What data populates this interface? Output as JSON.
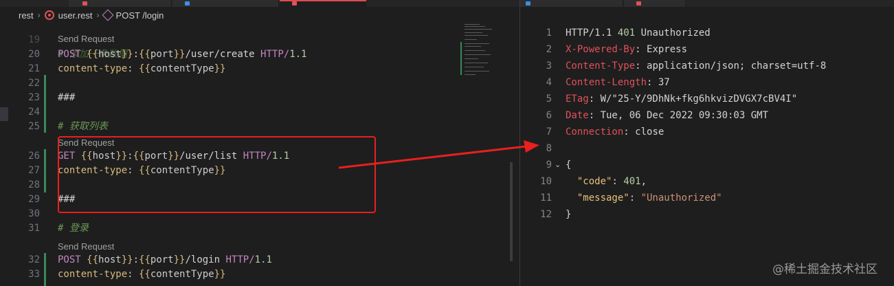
{
  "breadcrumb": {
    "folder": "rest",
    "file": "user.rest",
    "symbol": "POST /login"
  },
  "editor": {
    "lines": [
      {
        "num": "20",
        "tokens": [
          {
            "t": "POST",
            "c": "t-method"
          },
          {
            "t": " ",
            "c": ""
          },
          {
            "t": "{{",
            "c": "t-brace"
          },
          {
            "t": "host",
            "c": "t-var"
          },
          {
            "t": "}}",
            "c": "t-brace"
          },
          {
            "t": ":",
            "c": "t-path"
          },
          {
            "t": "{{",
            "c": "t-brace"
          },
          {
            "t": "port",
            "c": "t-var"
          },
          {
            "t": "}}",
            "c": "t-brace"
          },
          {
            "t": "/user/create ",
            "c": "t-path"
          },
          {
            "t": "HTTP/",
            "c": "t-proto"
          },
          {
            "t": "1.1",
            "c": "t-ver"
          }
        ]
      },
      {
        "num": "21",
        "tokens": [
          {
            "t": "content-type",
            "c": "t-hname"
          },
          {
            "t": ": ",
            "c": "t-sep"
          },
          {
            "t": "{{",
            "c": "t-brace"
          },
          {
            "t": "contentType",
            "c": "t-var"
          },
          {
            "t": "}}",
            "c": "t-brace"
          }
        ]
      },
      {
        "num": "22",
        "tokens": []
      },
      {
        "num": "23",
        "tokens": [
          {
            "t": "###",
            "c": "t-path"
          }
        ]
      },
      {
        "num": "24",
        "tokens": []
      },
      {
        "num": "25",
        "tokens": [
          {
            "t": "# 获取列表",
            "c": "t-comment"
          }
        ]
      },
      {
        "num": "26",
        "tokens": [
          {
            "t": "GET",
            "c": "t-method"
          },
          {
            "t": " ",
            "c": ""
          },
          {
            "t": "{{",
            "c": "t-brace"
          },
          {
            "t": "host",
            "c": "t-var"
          },
          {
            "t": "}}",
            "c": "t-brace"
          },
          {
            "t": ":",
            "c": "t-path"
          },
          {
            "t": "{{",
            "c": "t-brace"
          },
          {
            "t": "port",
            "c": "t-var"
          },
          {
            "t": "}}",
            "c": "t-brace"
          },
          {
            "t": "/user/list ",
            "c": "t-path"
          },
          {
            "t": "HTTP/",
            "c": "t-proto"
          },
          {
            "t": "1.1",
            "c": "t-ver"
          }
        ]
      },
      {
        "num": "27",
        "tokens": [
          {
            "t": "content-type",
            "c": "t-hname"
          },
          {
            "t": ": ",
            "c": "t-sep"
          },
          {
            "t": "{{",
            "c": "t-brace"
          },
          {
            "t": "contentType",
            "c": "t-var"
          },
          {
            "t": "}}",
            "c": "t-brace"
          }
        ]
      },
      {
        "num": "28",
        "tokens": []
      },
      {
        "num": "29",
        "tokens": [
          {
            "t": "###",
            "c": "t-path"
          }
        ]
      },
      {
        "num": "30",
        "tokens": []
      },
      {
        "num": "31",
        "tokens": [
          {
            "t": "# 登录",
            "c": "t-comment"
          }
        ]
      },
      {
        "num": "32",
        "tokens": [
          {
            "t": "POST",
            "c": "t-method"
          },
          {
            "t": " ",
            "c": ""
          },
          {
            "t": "{{",
            "c": "t-brace"
          },
          {
            "t": "host",
            "c": "t-var"
          },
          {
            "t": "}}",
            "c": "t-brace"
          },
          {
            "t": ":",
            "c": "t-path"
          },
          {
            "t": "{{",
            "c": "t-brace"
          },
          {
            "t": "port",
            "c": "t-var"
          },
          {
            "t": "}}",
            "c": "t-brace"
          },
          {
            "t": "/login ",
            "c": "t-path"
          },
          {
            "t": "HTTP/",
            "c": "t-proto"
          },
          {
            "t": "1.1",
            "c": "t-ver"
          }
        ]
      },
      {
        "num": "33",
        "tokens": [
          {
            "t": "content-type",
            "c": "t-hname"
          },
          {
            "t": ": ",
            "c": "t-sep"
          },
          {
            "t": "{{",
            "c": "t-brace"
          },
          {
            "t": "contentType",
            "c": "t-var"
          },
          {
            "t": "}}",
            "c": "t-brace"
          }
        ]
      }
    ],
    "partial_top_line": {
      "num": "19",
      "text": "# 添加一条数据"
    },
    "send_request_label": "Send Request"
  },
  "response": {
    "lines": [
      {
        "num": "1",
        "tokens": [
          {
            "t": "HTTP/1.1 ",
            "c": ""
          },
          {
            "t": "401",
            "c": "r-status"
          },
          {
            "t": " Unauthorized",
            "c": ""
          }
        ]
      },
      {
        "num": "2",
        "tokens": [
          {
            "t": "X-Powered-By",
            "c": "r-key"
          },
          {
            "t": ": Express",
            "c": ""
          }
        ]
      },
      {
        "num": "3",
        "tokens": [
          {
            "t": "Content-Type",
            "c": "r-key"
          },
          {
            "t": ": application/json; charset=utf-8",
            "c": ""
          }
        ]
      },
      {
        "num": "4",
        "tokens": [
          {
            "t": "Content-Length",
            "c": "r-key"
          },
          {
            "t": ": 37",
            "c": ""
          }
        ]
      },
      {
        "num": "5",
        "tokens": [
          {
            "t": "ETag",
            "c": "r-key"
          },
          {
            "t": ": W/\"25-Y/9DhNk+fkg6hkvizDVGX7cBV4I\"",
            "c": ""
          }
        ]
      },
      {
        "num": "6",
        "tokens": [
          {
            "t": "Date",
            "c": "r-key"
          },
          {
            "t": ": Tue, 06 Dec 2022 09:30:03 GMT",
            "c": ""
          }
        ]
      },
      {
        "num": "7",
        "tokens": [
          {
            "t": "Connection",
            "c": "r-key"
          },
          {
            "t": ": close",
            "c": ""
          }
        ]
      },
      {
        "num": "8",
        "tokens": []
      },
      {
        "num": "9",
        "tokens": [
          {
            "t": "{",
            "c": ""
          }
        ],
        "fold": true
      },
      {
        "num": "10",
        "tokens": [
          {
            "t": "  ",
            "c": ""
          },
          {
            "t": "\"code\"",
            "c": "r-jkey"
          },
          {
            "t": ": ",
            "c": ""
          },
          {
            "t": "401",
            "c": "r-jnum"
          },
          {
            "t": ",",
            "c": ""
          }
        ]
      },
      {
        "num": "11",
        "tokens": [
          {
            "t": "  ",
            "c": ""
          },
          {
            "t": "\"message\"",
            "c": "r-jkey"
          },
          {
            "t": ": ",
            "c": ""
          },
          {
            "t": "\"Unauthorized\"",
            "c": "r-jstr"
          }
        ]
      },
      {
        "num": "12",
        "tokens": [
          {
            "t": "}",
            "c": ""
          }
        ]
      }
    ]
  },
  "watermark": "@稀土掘金技术社区",
  "icons": {
    "rest_file": "rest-file-icon",
    "symbol": "cube-symbol-icon",
    "fold": "chevron-down-icon"
  },
  "colors": {
    "highlight": "#e8201e",
    "arrow": "#e8201e"
  }
}
